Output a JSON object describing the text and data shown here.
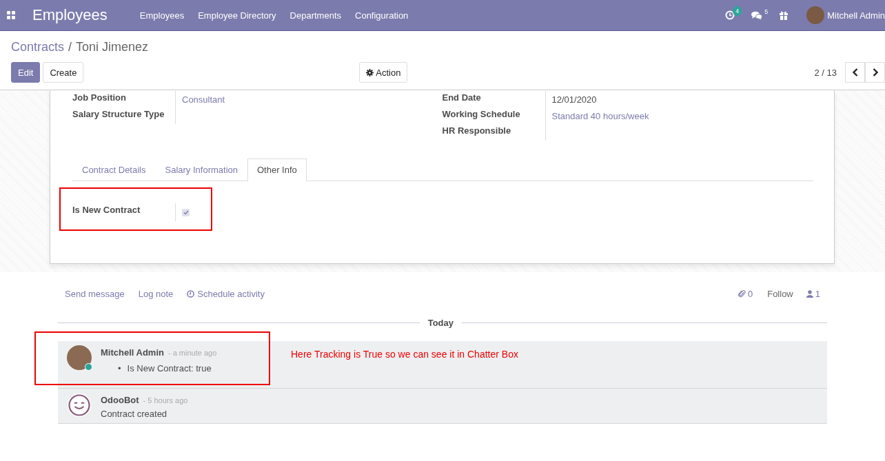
{
  "navbar": {
    "app_name": "Employees",
    "menu": [
      "Employees",
      "Employee Directory",
      "Departments",
      "Configuration"
    ],
    "activity_count": "4",
    "message_count": "5",
    "user": "Mitchell Admin"
  },
  "breadcrumb": {
    "parent": "Contracts",
    "separator": "/",
    "current": "Toni Jimenez"
  },
  "buttons": {
    "edit": "Edit",
    "create": "Create",
    "action": "Action"
  },
  "pager": "2 / 13",
  "fields_left": [
    {
      "label": "Job Position",
      "value": "Consultant",
      "kind": "link"
    },
    {
      "label": "Salary Structure Type",
      "kind": "empty"
    }
  ],
  "fields_right": [
    {
      "label": "End Date",
      "value": "12/01/2020",
      "kind": "text"
    },
    {
      "label": "Working Schedule",
      "value": "Standard 40 hours/week",
      "kind": "link"
    },
    {
      "label": "HR Responsible",
      "kind": "empty"
    }
  ],
  "tabs": [
    {
      "label": "Contract Details",
      "selected": false
    },
    {
      "label": "Salary Information",
      "selected": false
    },
    {
      "label": "Other Info",
      "selected": true
    }
  ],
  "tab_field": {
    "label": "Is New Contract",
    "checked": true,
    "highlighted": true
  },
  "chatter": {
    "send_message": "Send message",
    "log_note": "Log note",
    "schedule_activity": "Schedule activity",
    "attachments": "0",
    "follow": "Follow",
    "followers": "1",
    "date_separator": "Today",
    "annotation": "Here Tracking is True so we can see it in Chatter Box",
    "messages": [
      {
        "author": "Mitchell Admin",
        "time": "- a minute ago",
        "is_bot": false,
        "online": true,
        "kind": "tracking",
        "highlighted": true,
        "changes": [
          {
            "marker": "•",
            "text": "Is New Contract: true"
          }
        ]
      },
      {
        "author": "OdooBot",
        "time": "- 5 hours ago",
        "is_bot": true,
        "online": false,
        "kind": "text",
        "highlighted": false,
        "body": "Contract created"
      }
    ]
  }
}
